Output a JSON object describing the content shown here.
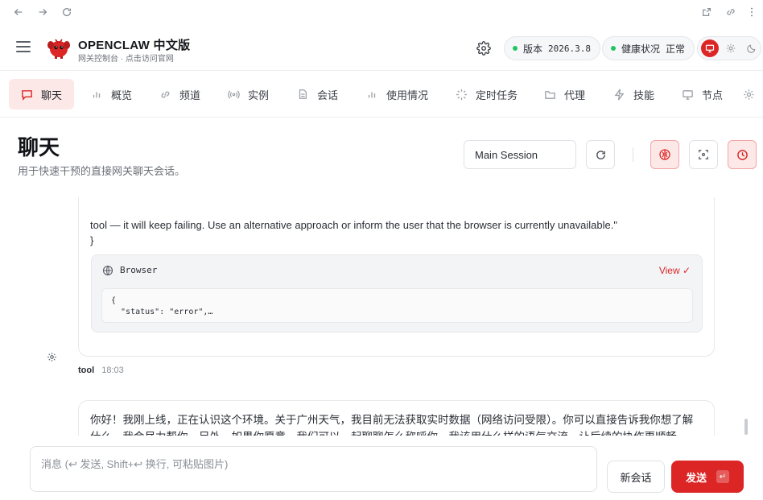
{
  "brand": {
    "name": "OPENCLAW 中文版",
    "subtitle": "网关控制台 · 点击访问官网"
  },
  "status": {
    "version_label": "版本",
    "version_value": "2026.3.8",
    "health_label": "健康状况",
    "health_value": "正常",
    "status_color": "#22c55e"
  },
  "accent_color": "#dc2626",
  "tabs": [
    {
      "label": "聊天",
      "icon": "chat-bubble-icon",
      "active": true
    },
    {
      "label": "概览",
      "icon": "bar-chart-icon"
    },
    {
      "label": "频道",
      "icon": "link-icon"
    },
    {
      "label": "实例",
      "icon": "radio-signal-icon"
    },
    {
      "label": "会话",
      "icon": "document-icon"
    },
    {
      "label": "使用情况",
      "icon": "bar-chart-icon"
    },
    {
      "label": "定时任务",
      "icon": "spinner-icon"
    },
    {
      "label": "代理",
      "icon": "folder-icon"
    },
    {
      "label": "技能",
      "icon": "lightning-icon"
    },
    {
      "label": "节点",
      "icon": "monitor-icon"
    }
  ],
  "page": {
    "title": "聊天",
    "subtitle": "用于快速干预的直接网关聊天会话。"
  },
  "session": {
    "selected": "Main Session"
  },
  "messages": {
    "tool_output_tail": "tool — it will keep failing. Use an alternative approach or inform the user that the browser is currently unavailable.\"",
    "closing_brace": "}",
    "tool_card": {
      "name": "Browser",
      "view_label": "View ✓",
      "code_preview": "{\n  \"status\": \"error\",…"
    },
    "tool_meta": {
      "sender": "tool",
      "time": "18:03"
    },
    "assistant_text": "你好！我刚上线，正在认识这个环境。关于广州天气，我目前无法获取实时数据（网络访问受限）。你可以直接告诉我你想了解什么，我会尽力帮你。另外，如果你愿意，我们可以一起聊聊怎么称呼你、我该用什么样的语气交流，让后续的协作更顺畅。"
  },
  "composer": {
    "placeholder": "消息 (↩ 发送, Shift+↩ 换行, 可粘贴图片)",
    "new_session_label": "新会话",
    "send_label": "发送",
    "send_kbd": "↵"
  }
}
